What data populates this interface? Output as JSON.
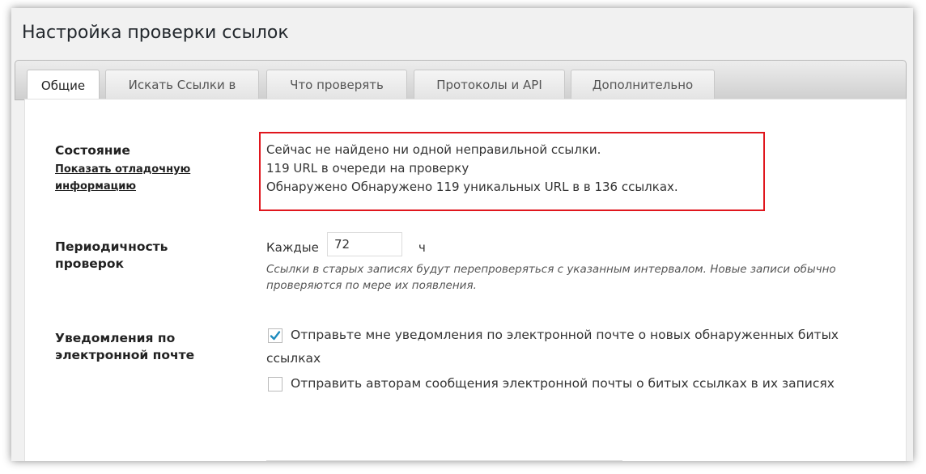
{
  "page": {
    "title": "Настройка проверки ссылок"
  },
  "tabs": [
    {
      "label": "Общие",
      "active": true
    },
    {
      "label": "Искать Ссылки в",
      "active": false
    },
    {
      "label": "Что проверять",
      "active": false
    },
    {
      "label": "Протоколы и API",
      "active": false
    },
    {
      "label": "Дополнительно",
      "active": false
    }
  ],
  "status": {
    "label": "Состояние",
    "debug_link": "Показать отладочную информацию",
    "lines": [
      "Сейчас не найдено ни одной неправильной ссылки.",
      "119 URL в очереди на проверку",
      "Обнаружено Обнаружено 119 уникальных URL в в 136 ссылках."
    ],
    "highlight_color": "#e0161d"
  },
  "interval": {
    "label": "Периодичность проверок",
    "prefix": "Каждые",
    "value": "72",
    "unit": "ч",
    "description": "Ссылки в старых записях будут перепроверяться с указанным интервалом. Новые записи обычно проверяются по мере их появления."
  },
  "notifications": {
    "label": "Уведомления по электронной почте",
    "options": [
      {
        "text": "Отправьте мне уведомления по электронной почте о новых обнаруженных битых ссылках",
        "checked": true
      },
      {
        "text": "Отправить авторам сообщения электронной почты о битых ссылках в их записях",
        "checked": false
      }
    ]
  },
  "icons": {
    "checkmark": "checkmark-icon"
  }
}
